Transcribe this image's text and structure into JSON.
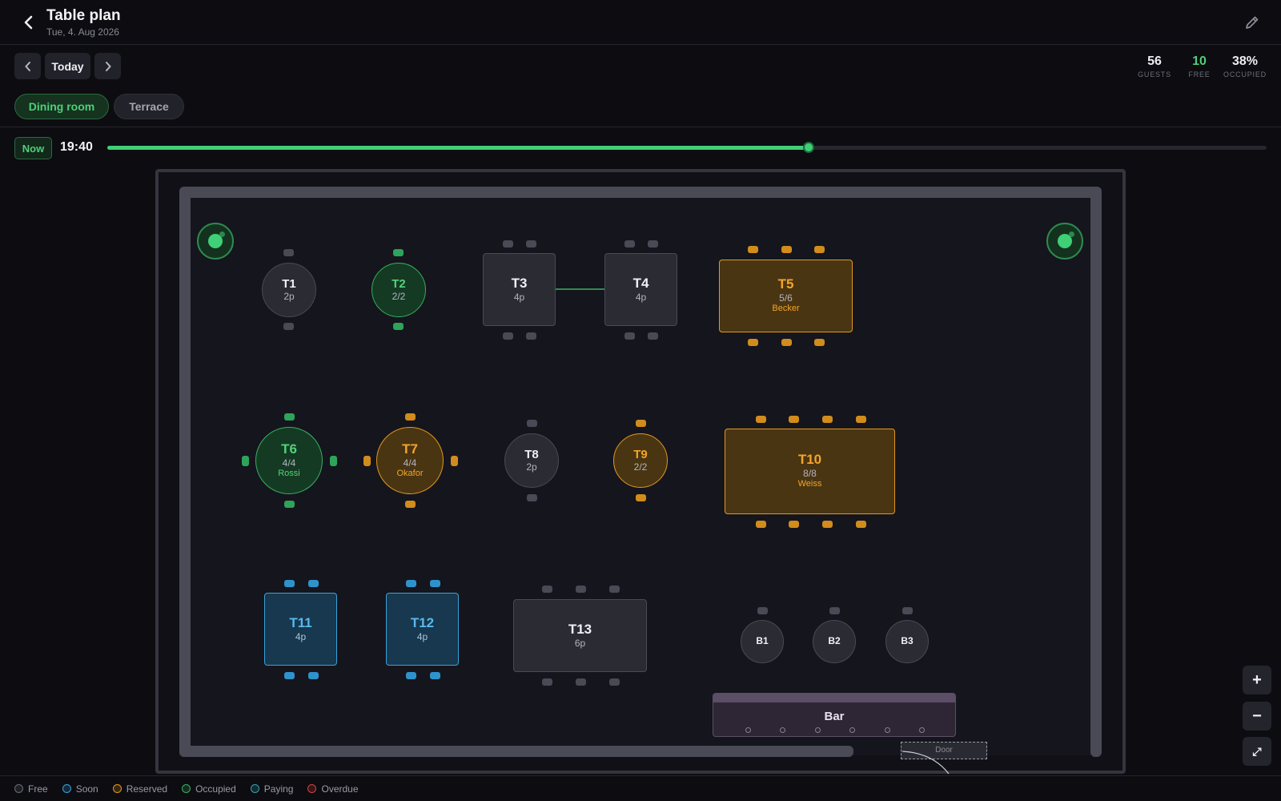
{
  "header": {
    "title": "Table plan",
    "date": "Tue, 4. Aug 2026"
  },
  "nav": {
    "today_label": "Today"
  },
  "stats": [
    {
      "value": "56",
      "label": "GUESTS",
      "color": "#eeeef2"
    },
    {
      "value": "10",
      "label": "FREE",
      "color": "#4fcf78"
    },
    {
      "value": "38%",
      "label": "OCCUPIED",
      "color": "#eeeef2"
    }
  ],
  "rooms": [
    {
      "label": "Dining room",
      "active": true
    },
    {
      "label": "Terrace",
      "active": false
    }
  ],
  "timeline": {
    "now_label": "Now",
    "time": "19:40",
    "progress": 0.605
  },
  "tables": [
    {
      "id": "T1",
      "shape": "round",
      "status": "free",
      "sub": "2p",
      "guest": ""
    },
    {
      "id": "T2",
      "shape": "round",
      "status": "occupied",
      "sub": "2/2",
      "guest": ""
    },
    {
      "id": "T3",
      "shape": "rect",
      "status": "free",
      "sub": "4p",
      "guest": ""
    },
    {
      "id": "T4",
      "shape": "rect",
      "status": "free",
      "sub": "4p",
      "guest": ""
    },
    {
      "id": "T5",
      "shape": "rect",
      "status": "reserved",
      "sub": "5/6",
      "guest": "Becker"
    },
    {
      "id": "T6",
      "shape": "round",
      "status": "occupied",
      "sub": "4/4",
      "guest": "Rossi"
    },
    {
      "id": "T7",
      "shape": "round",
      "status": "reserved",
      "sub": "4/4",
      "guest": "Okafor"
    },
    {
      "id": "T8",
      "shape": "round",
      "status": "free",
      "sub": "2p",
      "guest": ""
    },
    {
      "id": "T9",
      "shape": "round",
      "status": "reserved",
      "sub": "2/2",
      "guest": ""
    },
    {
      "id": "T10",
      "shape": "rect",
      "status": "reserved",
      "sub": "8/8",
      "guest": "Weiss"
    },
    {
      "id": "T11",
      "shape": "rect",
      "status": "soon",
      "sub": "4p",
      "guest": ""
    },
    {
      "id": "T12",
      "shape": "rect",
      "status": "soon",
      "sub": "4p",
      "guest": ""
    },
    {
      "id": "T13",
      "shape": "rect",
      "status": "free",
      "sub": "6p",
      "guest": ""
    },
    {
      "id": "B1",
      "shape": "round",
      "status": "free",
      "sub": "",
      "guest": ""
    },
    {
      "id": "B2",
      "shape": "round",
      "status": "free",
      "sub": "",
      "guest": ""
    },
    {
      "id": "B3",
      "shape": "round",
      "status": "free",
      "sub": "",
      "guest": ""
    }
  ],
  "bar": {
    "label": "Bar"
  },
  "door": {
    "label": "Door"
  },
  "zoom": {
    "in": "+",
    "out": "−",
    "fit": "⤢"
  },
  "legend": [
    {
      "label": "Free",
      "color": "#6a6a76"
    },
    {
      "label": "Soon",
      "color": "#37a2dc"
    },
    {
      "label": "Reserved",
      "color": "#e1981f"
    },
    {
      "label": "Occupied",
      "color": "#37b061"
    },
    {
      "label": "Paying",
      "color": "#3aa0b0"
    },
    {
      "label": "Overdue",
      "color": "#d94040"
    }
  ],
  "colors": {
    "accent": "#3fcf76",
    "reserved": "#e1981f",
    "soon": "#37a2dc",
    "free": "#4a4a56"
  }
}
